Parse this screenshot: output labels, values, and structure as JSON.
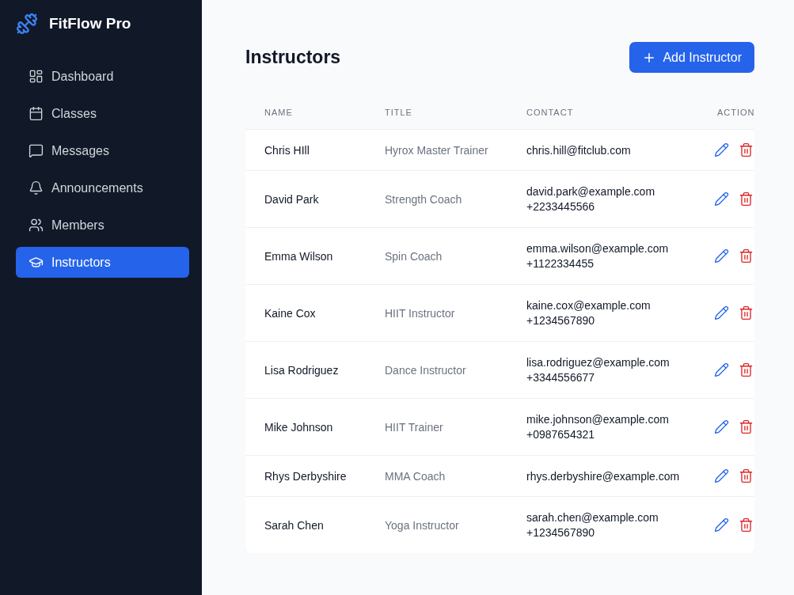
{
  "sidebar": {
    "brand": "FitFlow Pro",
    "items": [
      {
        "kind": "dashboard",
        "label": "Dashboard",
        "selected": false
      },
      {
        "kind": "calendar",
        "label": "Classes",
        "selected": false
      },
      {
        "kind": "messages",
        "label": "Messages",
        "selected": false
      },
      {
        "kind": "bell",
        "label": "Announcements",
        "selected": false
      },
      {
        "kind": "users",
        "label": "Members",
        "selected": false
      },
      {
        "kind": "cap",
        "label": "Instructors",
        "selected": true
      }
    ]
  },
  "page": {
    "title": "Instructors",
    "add_button": "Add Instructor"
  },
  "table": {
    "columns": [
      "NAME",
      "TITLE",
      "CONTACT",
      "ACTION"
    ],
    "rows": [
      {
        "name": "Chris HIll",
        "title": "Hyrox Master Trainer",
        "email": "chris.hill@fitclub.com"
      },
      {
        "name": "David Park",
        "title": "Strength Coach",
        "email": "david.park@example.com",
        "phone": "+2233445566"
      },
      {
        "name": "Emma Wilson",
        "title": "Spin Coach",
        "email": "emma.wilson@example.com",
        "phone": "+1122334455"
      },
      {
        "name": "Kaine Cox",
        "title": "HIIT Instructor",
        "email": "kaine.cox@example.com",
        "phone": "+1234567890"
      },
      {
        "name": "Lisa Rodriguez",
        "title": "Dance Instructor",
        "email": "lisa.rodriguez@example.com",
        "phone": "+3344556677"
      },
      {
        "name": "Mike Johnson",
        "title": "HIIT Trainer",
        "email": "mike.johnson@example.com",
        "phone": "+0987654321"
      },
      {
        "name": "Rhys Derbyshire",
        "title": "MMA Coach",
        "email": "rhys.derbyshire@example.com"
      },
      {
        "name": "Sarah Chen",
        "title": "Yoga Instructor",
        "email": "sarah.chen@example.com",
        "phone": "+1234567890"
      }
    ]
  }
}
